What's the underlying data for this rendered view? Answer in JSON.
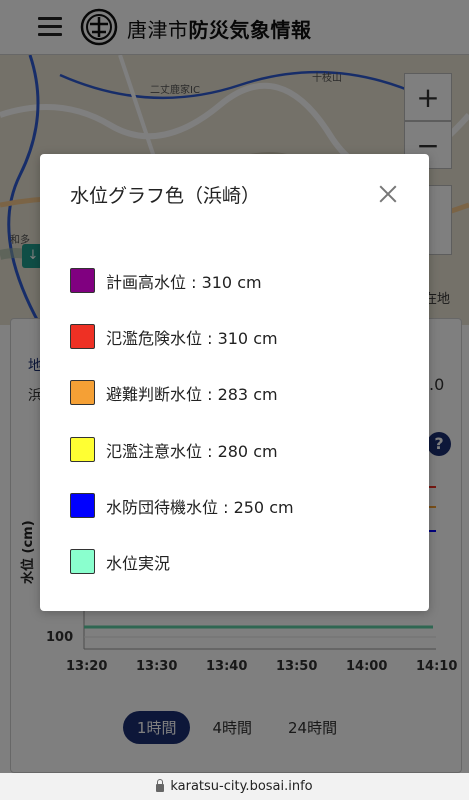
{
  "header": {
    "brand_city": "唐津市",
    "brand_main": "防災気象情報"
  },
  "map": {
    "labels": [
      "二丈鹿家IC",
      "十枝山",
      "和多"
    ],
    "controls": {
      "zoom_in": "+",
      "zoom_out": "−",
      "location_label": "在地"
    }
  },
  "sheet": {
    "partial_1": "地",
    "partial_2": "浜",
    "partial_3": ".0",
    "y_axis_label": "水位 (cm)",
    "y_ticks": [
      "100"
    ],
    "x_ticks": [
      "13:20",
      "13:30",
      "13:40",
      "13:50",
      "14:00",
      "14:10"
    ],
    "ranges": [
      {
        "label": "1時間",
        "active": true
      },
      {
        "label": "4時間",
        "active": false
      },
      {
        "label": "24時間",
        "active": false
      }
    ]
  },
  "modal": {
    "title": "水位グラフ色（浜崎）",
    "legend": [
      {
        "label": "計画高水位 : 310 cm",
        "color": "#800080"
      },
      {
        "label": "氾濫危険水位 : 310 cm",
        "color": "#ee3024"
      },
      {
        "label": "避難判断水位 : 283 cm",
        "color": "#f5a035"
      },
      {
        "label": "氾濫注意水位 : 280 cm",
        "color": "#ffff33"
      },
      {
        "label": "水防団待機水位 : 250 cm",
        "color": "#0000ff"
      },
      {
        "label": "水位実況",
        "color": "#8affce"
      }
    ]
  },
  "urlbar": {
    "url": "karatsu-city.bosai.info"
  }
}
